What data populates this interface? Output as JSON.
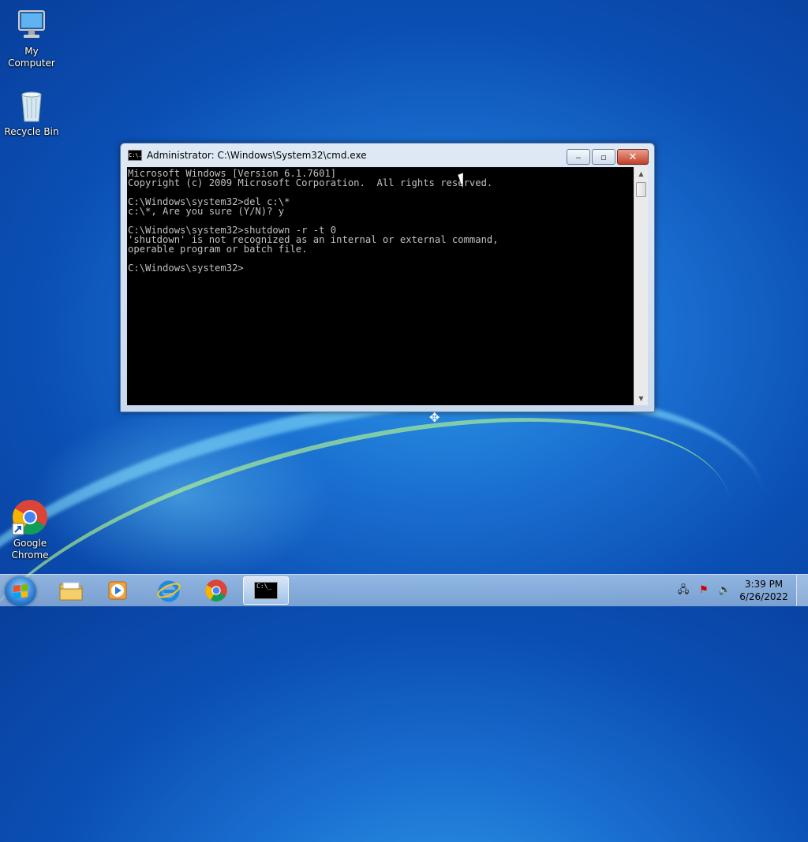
{
  "desktop": {
    "icons": [
      {
        "label": "My Computer",
        "icon": "computer-icon"
      },
      {
        "label": "Recycle Bin",
        "icon": "recycle-bin-icon"
      },
      {
        "label_line1": "Google",
        "label_line2": "Chrome",
        "icon": "chrome-icon"
      }
    ]
  },
  "window": {
    "title": "Administrator: C:\\Windows\\System32\\cmd.exe",
    "title_icon_text": "C:\\.",
    "buttons": {
      "minimize": "‒",
      "maximize": "▫",
      "close": "✕"
    },
    "console_lines": [
      "Microsoft Windows [Version 6.1.7601]",
      "Copyright (c) 2009 Microsoft Corporation.  All rights reserved.",
      "",
      "C:\\Windows\\system32>del c:\\*",
      "c:\\*, Are you sure (Y/N)? y",
      "",
      "C:\\Windows\\system32>shutdown -r -t 0",
      "'shutdown' is not recognized as an internal or external command,",
      "operable program or batch file.",
      "",
      "C:\\Windows\\system32>"
    ]
  },
  "taskbar": {
    "items": [
      {
        "name": "explorer",
        "icon": "folder-icon"
      },
      {
        "name": "media-player",
        "icon": "media-player-icon"
      },
      {
        "name": "internet-explorer",
        "icon": "internet-explorer-icon"
      },
      {
        "name": "chrome",
        "icon": "chrome-icon"
      },
      {
        "name": "cmd",
        "icon": "cmd-icon",
        "label": "C:\\_",
        "active": true
      }
    ],
    "tray": {
      "icons": [
        "network-icon",
        "action-center-icon",
        "volume-icon"
      ]
    },
    "clock": {
      "time": "3:39 PM",
      "date": "6/26/2022"
    }
  }
}
